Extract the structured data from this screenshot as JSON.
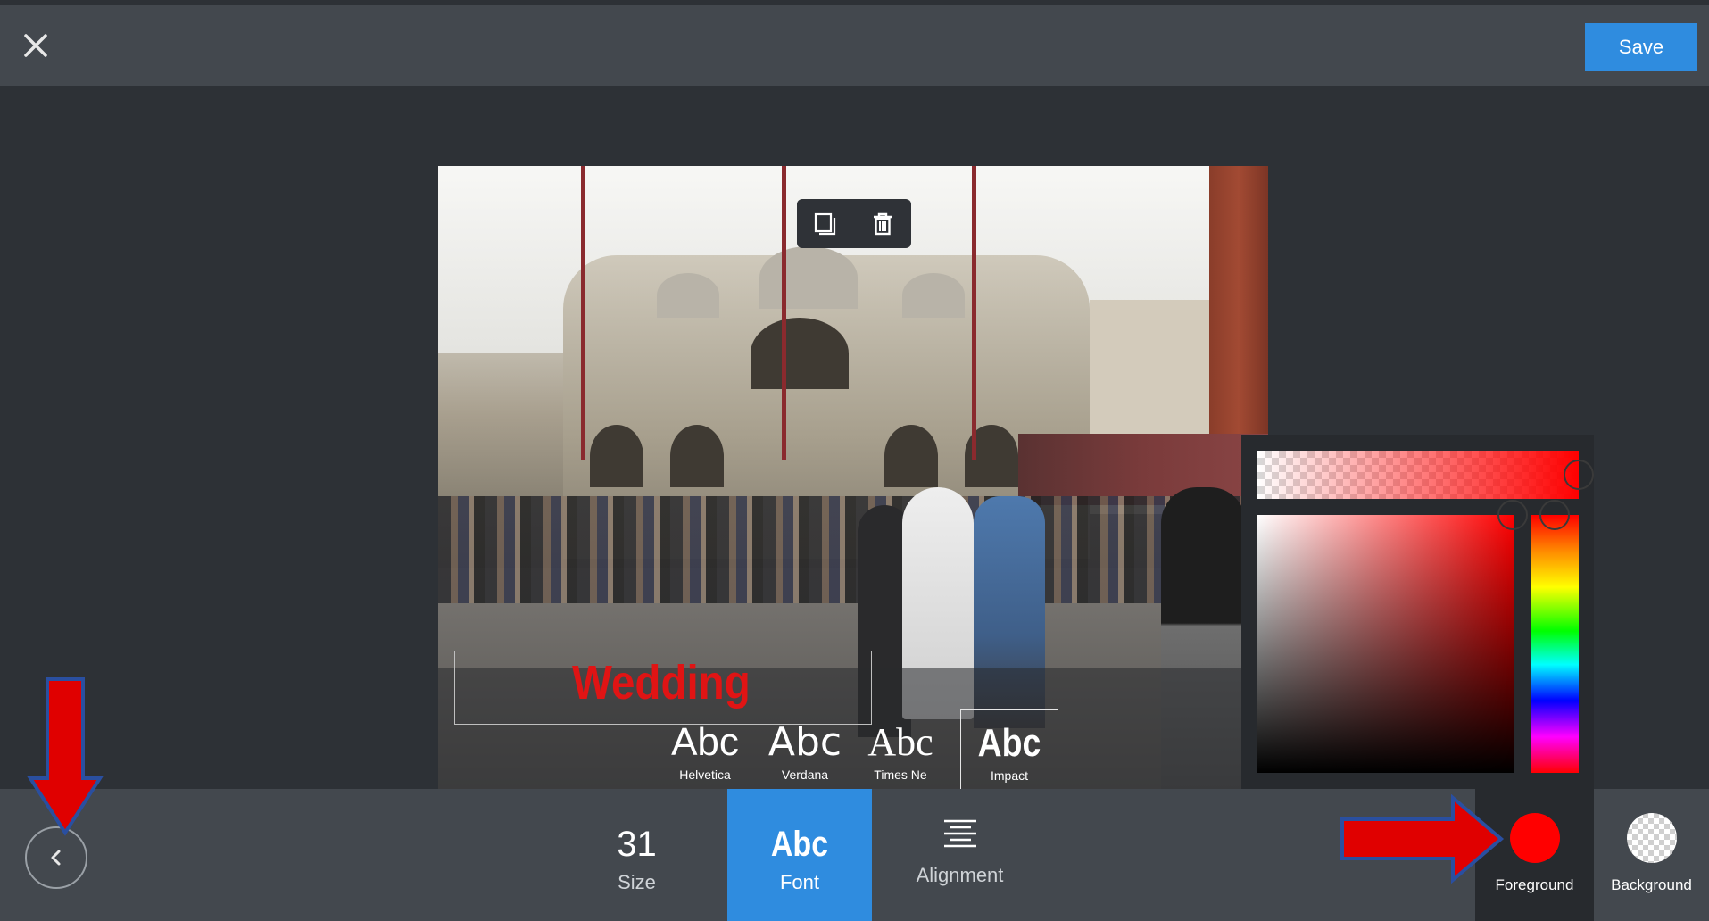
{
  "header": {
    "save_label": "Save",
    "close_icon": "close-icon"
  },
  "canvas": {
    "overlay_text": "Wedding",
    "overlay_text_color": "#e01414",
    "photo_toolbar": {
      "duplicate_icon": "duplicate-icon",
      "delete_icon": "trash-icon"
    }
  },
  "font_options": [
    {
      "sample": "Abc",
      "name": "Helvetica"
    },
    {
      "sample": "Abc",
      "name": "Verdana"
    },
    {
      "sample": "Abc",
      "name": "Times Ne"
    },
    {
      "sample": "Abc",
      "name": "Impact",
      "selected": true
    }
  ],
  "toolbar": {
    "size_value": "31",
    "size_label": "Size",
    "font_sample": "Abc",
    "font_label": "Font",
    "alignment_label": "Alignment",
    "foreground_label": "Foreground",
    "background_label": "Background",
    "foreground_color": "#ff0000"
  },
  "colors": {
    "accent": "#2f8cdf",
    "annotation_arrow": "#e00000"
  }
}
